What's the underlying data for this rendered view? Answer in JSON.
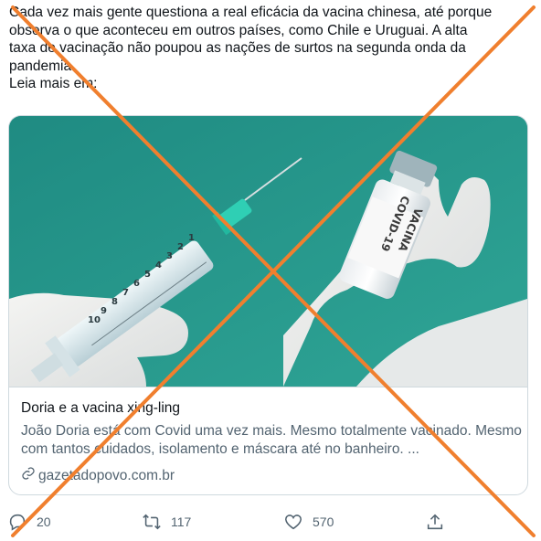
{
  "tweet": {
    "lines": [
      "Cada vez mais gente questiona a real eficácia da vacina chinesa, até porque",
      "observa o que aconteceu em outros países, como Chile e Uruguai. A alta",
      "taxa de vacinação não poupou as nações de surtos na segunda onda da",
      "pandemia.",
      "Leia mais em:"
    ]
  },
  "card": {
    "image_text": {
      "vial_label_1": "COVID-19",
      "vial_label_2": "VACINA",
      "syringe_marks": [
        "1",
        "2",
        "3",
        "4",
        "5",
        "6",
        "7",
        "8",
        "9",
        "10"
      ]
    },
    "title": "Doria e a vacina xing-ling",
    "description": "João Doria está com Covid uma vez mais. Mesmo totalmente vacinado. Mesmo com tantos cuidados, isolamento e máscara até no banheiro. ...",
    "domain": "gazetadopovo.com.br"
  },
  "actions": {
    "reply_count": "20",
    "retweet_count": "117",
    "like_count": "570"
  },
  "icons": {
    "reply": "reply-icon",
    "retweet": "retweet-icon",
    "like": "heart-icon",
    "share": "share-icon",
    "link": "link-icon"
  },
  "colors": {
    "overlay_x": "#f07f2e",
    "image_background": "#2a9b90",
    "secondary_text": "#536471",
    "border": "#cfd9de"
  }
}
